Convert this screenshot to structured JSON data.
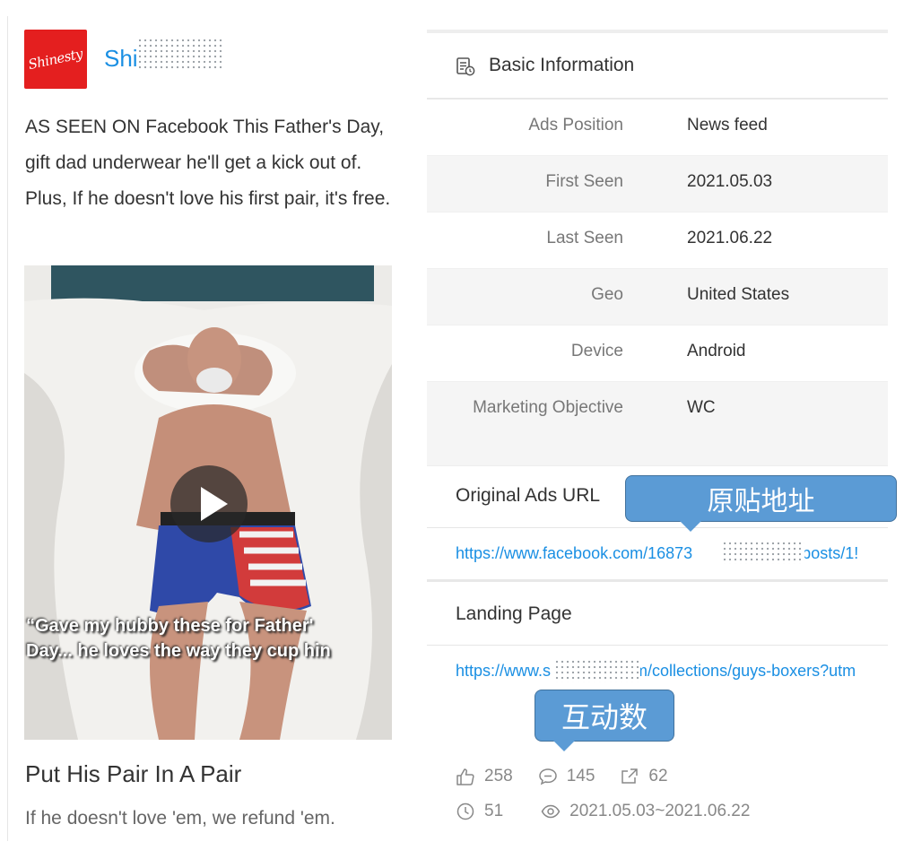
{
  "advertiser": {
    "name": "Shi"
  },
  "ad": {
    "text": "AS SEEN ON Facebook This Father's Day, gift dad underwear he'll get a kick out of. Plus, If he doesn't love his first pair, it's free.",
    "video_caption_line1": "“Gave my hubby these for Father'",
    "video_caption_line2": "Day... he loves the way they cup hin",
    "headline": "Put His Pair In A Pair",
    "description": "If he doesn't love 'em, we refund 'em."
  },
  "basic_info": {
    "title": "Basic Information",
    "rows": [
      {
        "label": "Ads Position",
        "value": "News feed"
      },
      {
        "label": "First Seen",
        "value": "2021.05.03"
      },
      {
        "label": "Last Seen",
        "value": "2021.06.22"
      },
      {
        "label": "Geo",
        "value": "United States"
      },
      {
        "label": "Device",
        "value": "Android"
      },
      {
        "label": "Marketing Objective",
        "value": "WC"
      }
    ]
  },
  "original_ads_url": {
    "title": "Original Ads URL",
    "link_start": "https://www.facebook.com/16873",
    "link_end": "23/posts/1!"
  },
  "landing_page": {
    "title": "Landing Page",
    "link_start": "https://www.s",
    "link_end": "m/collections/guys-boxers?utm"
  },
  "annotations": {
    "original_url_callout": "原贴地址",
    "engagement_callout": "互动数"
  },
  "stats": {
    "likes": "258",
    "comments": "145",
    "shares": "62",
    "duration_days": "51",
    "date_range": "2021.05.03~2021.06.22"
  },
  "colors": {
    "brand_red": "#e41f1f",
    "link_blue": "#1a8fe3",
    "callout_blue": "#5b9bd5"
  }
}
